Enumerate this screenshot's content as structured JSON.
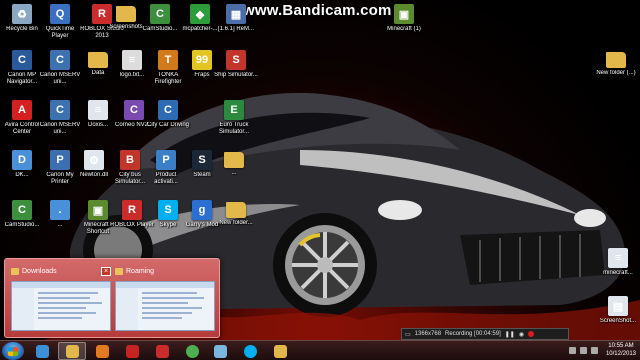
{
  "watermark": "www.Bandicam.com",
  "icons": [
    {
      "label": "Recycle Bin",
      "glyph": "recycle-bin-icon",
      "color": "#8aa7c4",
      "char": "♻"
    },
    {
      "label": "QuickTime Player",
      "glyph": "quicktime-icon",
      "color": "#3a6fc2",
      "char": "Q"
    },
    {
      "label": "ROBLOX Studio 2013",
      "glyph": "roblox-studio-icon",
      "color": "#cc2b2b",
      "char": "R"
    },
    {
      "label": "Screenshots",
      "glyph": "folder-icon",
      "color": "#e3b84a",
      "char": ""
    },
    {
      "label": "CamStudio...",
      "glyph": "camstudio-icon",
      "color": "#3d8f3d",
      "char": "C"
    },
    {
      "label": "mcpatcher-...",
      "glyph": "mcpatcher-icon",
      "color": "#2d9b3a",
      "char": "◆"
    },
    {
      "label": "[1.6.1] ReM...",
      "glyph": "minecraft-map-icon",
      "color": "#4b6ea9",
      "char": "▦"
    },
    {
      "label": "Minecraft (1)",
      "glyph": "minecraft-icon",
      "color": "#5c8a2e",
      "char": "▣"
    },
    {
      "label": "Canon MP Navigator...",
      "glyph": "canon-navigator-icon",
      "color": "#2b5a9c",
      "char": "C"
    },
    {
      "label": "Canon MSERV uni...",
      "glyph": "canon-mserv-icon",
      "color": "#3c72b0",
      "char": "C"
    },
    {
      "label": "Data",
      "glyph": "folder-icon",
      "color": "#e3b84a",
      "char": ""
    },
    {
      "label": "logo.txt...",
      "glyph": "text-file-icon",
      "color": "#dcdcdc",
      "char": "≡"
    },
    {
      "label": "TONKA Firefighter",
      "glyph": "tonka-icon",
      "color": "#d07a1c",
      "char": "T"
    },
    {
      "label": "Fraps",
      "glyph": "fraps-icon",
      "color": "#e2c422",
      "char": "99"
    },
    {
      "label": "Ship Simulator...",
      "glyph": "ship-sim-icon",
      "color": "#c2352b",
      "char": "S"
    },
    {
      "label": "New folder (...)",
      "glyph": "folder-icon",
      "color": "#e3b84a",
      "char": ""
    },
    {
      "label": "Avira Control Center",
      "glyph": "avira-icon",
      "color": "#d42020",
      "char": "A"
    },
    {
      "label": "Canon MSERV uni...",
      "glyph": "canon-mserv-icon",
      "color": "#3c72b0",
      "char": "C"
    },
    {
      "label": "Doxis...",
      "glyph": "document-icon",
      "color": "#dfe6ee",
      "char": "≡"
    },
    {
      "label": "Corneo NV2...",
      "glyph": "cornea-icon",
      "color": "#7a4ab0",
      "char": "C"
    },
    {
      "label": "City Car Driving",
      "glyph": "city-car-icon",
      "color": "#2f6bb5",
      "char": "C"
    },
    {
      "label": "Euro Truck Simulator...",
      "glyph": "euro-truck-icon",
      "color": "#2b8a3e",
      "char": "E"
    },
    {
      "label": "DK...",
      "glyph": "shortcut-icon",
      "color": "#4a90d9",
      "char": "D"
    },
    {
      "label": "Canon My Printer",
      "glyph": "printer-icon",
      "color": "#3c6fb0",
      "char": "P"
    },
    {
      "label": "Newton.dll",
      "glyph": "dll-file-icon",
      "color": "#dfe6ee",
      "char": "⚙"
    },
    {
      "label": "City bus Simulator...",
      "glyph": "bus-sim-icon",
      "color": "#c2352b",
      "char": "B"
    },
    {
      "label": "Product activati...",
      "glyph": "activation-icon",
      "color": "#3a7fc8",
      "char": "P"
    },
    {
      "label": "Steam",
      "glyph": "steam-icon",
      "color": "#1b2838",
      "char": "S"
    },
    {
      "label": "...",
      "glyph": "folder-icon",
      "color": "#e3b84a",
      "char": ""
    },
    {
      "label": "CamStudio...",
      "glyph": "camstudio-icon",
      "color": "#3d8f3d",
      "char": "C"
    },
    {
      "label": "...",
      "glyph": "shortcut-icon",
      "color": "#4a90d9",
      "char": "."
    },
    {
      "label": "Minecraft - Shortcut",
      "glyph": "minecraft-icon",
      "color": "#5c8a2e",
      "char": "▣"
    },
    {
      "label": "ROBLOX Player",
      "glyph": "roblox-icon",
      "color": "#cc2b2b",
      "char": "R"
    },
    {
      "label": "Skype",
      "glyph": "skype-icon",
      "color": "#00aff0",
      "char": "S"
    },
    {
      "label": "Garry's Mod",
      "glyph": "garrys-mod-icon",
      "color": "#2a6fd1",
      "char": "g"
    },
    {
      "label": "New folder...",
      "glyph": "folder-icon",
      "color": "#e3b84a",
      "char": ""
    },
    {
      "label": "minecraft...",
      "glyph": "document-icon",
      "color": "#dfe6ee",
      "char": "≡"
    },
    {
      "label": "ScreenShot...",
      "glyph": "image-file-icon",
      "color": "#dfe6ee",
      "char": "▤"
    }
  ],
  "preview": {
    "windows": [
      {
        "title": "Downloads"
      },
      {
        "title": "Roaming"
      }
    ]
  },
  "bandicam": {
    "resolution": "1366x768",
    "status": "Recording [00:04:59]"
  },
  "taskbar": {
    "buttons": [
      {
        "name": "internet-explorer-icon",
        "color": "#3a8fd8"
      },
      {
        "name": "file-explorer-icon",
        "color": "#e3b84a"
      },
      {
        "name": "media-player-icon",
        "color": "#e07b21"
      },
      {
        "name": "bandicam-icon",
        "color": "#c72323"
      },
      {
        "name": "roblox-icon",
        "color": "#cc2b2b"
      },
      {
        "name": "chrome-icon",
        "color": "#4caf50"
      },
      {
        "name": "paint-icon",
        "color": "#7bb5e0"
      },
      {
        "name": "skype-icon",
        "color": "#00aff0"
      },
      {
        "name": "file-explorer-icon",
        "color": "#e3b84a"
      }
    ],
    "time": "10:55 AM",
    "date": "10/12/2013"
  }
}
